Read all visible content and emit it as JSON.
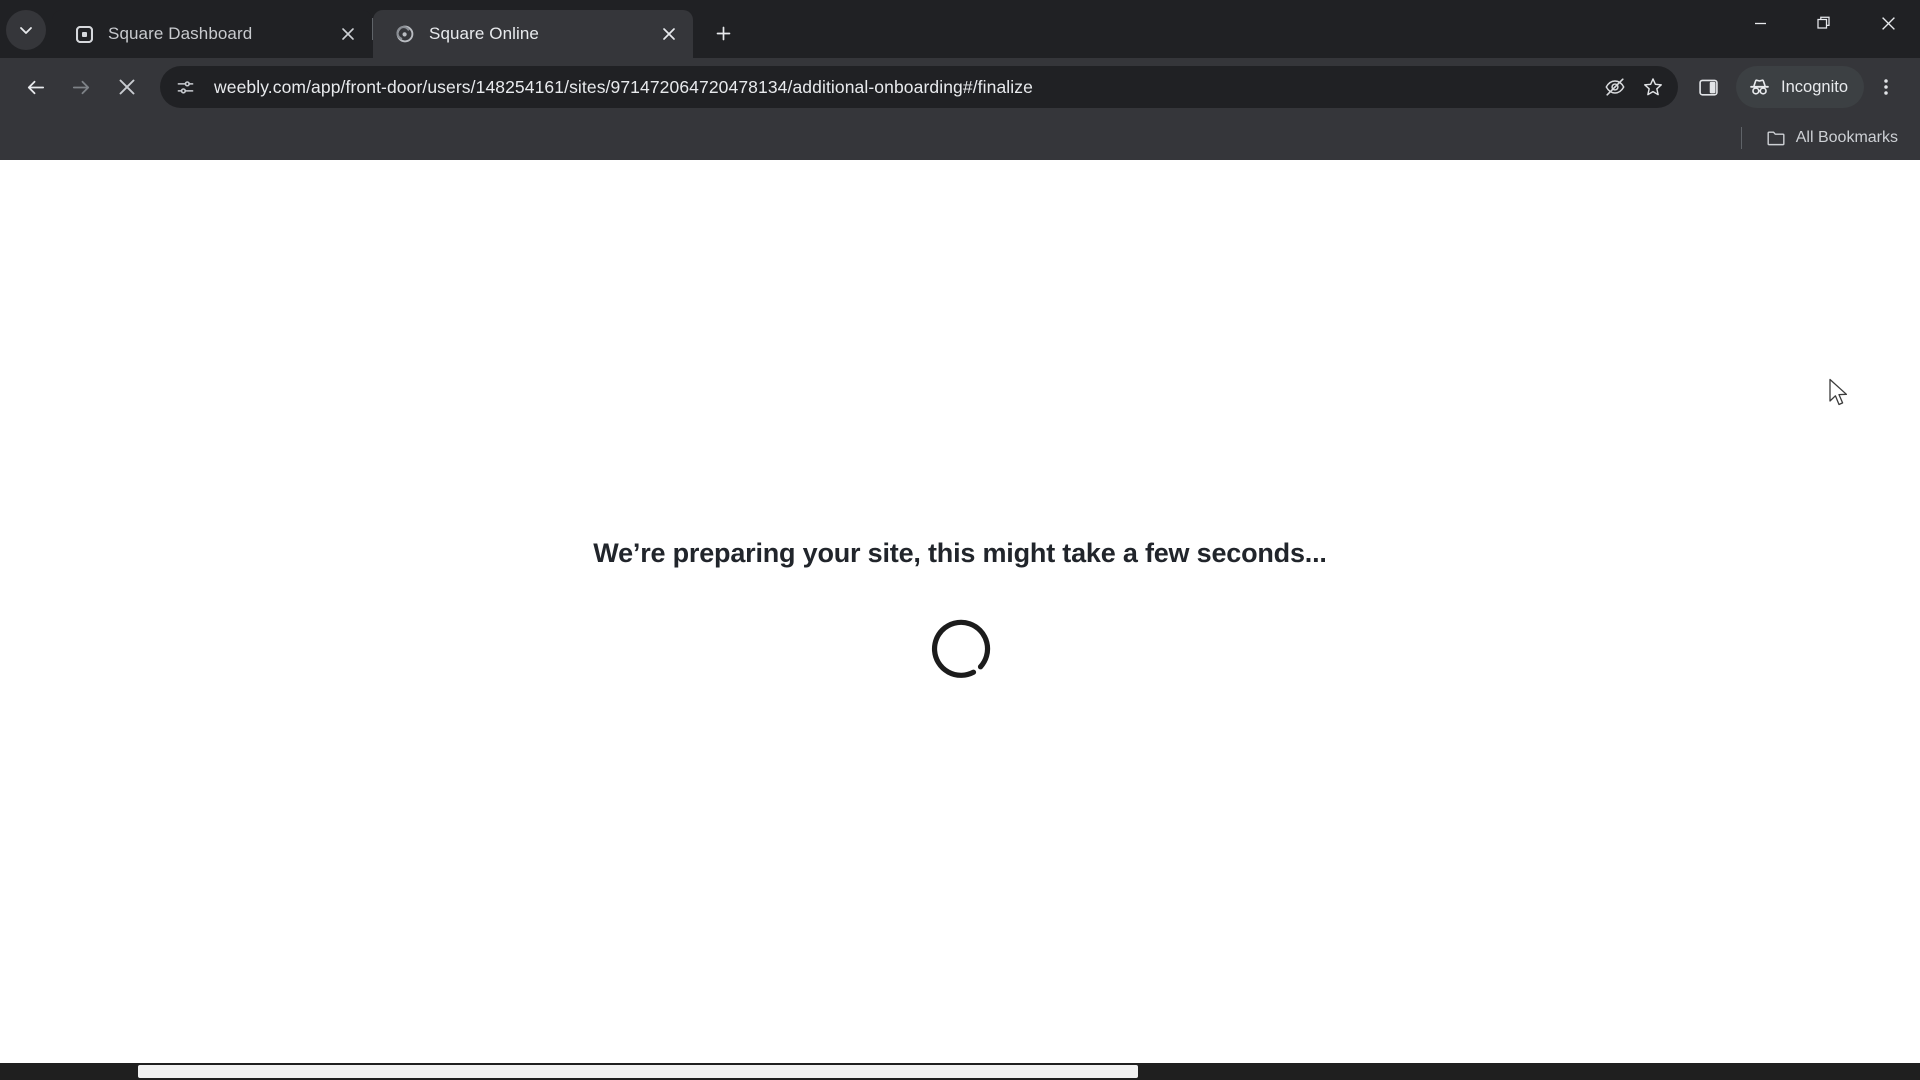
{
  "window": {
    "controls": [
      {
        "name": "minimize",
        "glyph": "minimize-icon"
      },
      {
        "name": "restore",
        "glyph": "restore-icon"
      },
      {
        "name": "close",
        "glyph": "close-icon"
      }
    ]
  },
  "tabstrip": {
    "tab_search_icon": "chevron-down-icon",
    "new_tab_icon": "plus-icon",
    "tabs": [
      {
        "title": "Square Dashboard",
        "favicon": "square-logo-icon",
        "active": false,
        "close_icon": "close-icon"
      },
      {
        "title": "Square Online",
        "favicon": "square-online-logo-icon",
        "active": true,
        "close_icon": "close-icon"
      }
    ]
  },
  "toolbar": {
    "back_icon": "arrow-left-icon",
    "forward_icon": "arrow-right-icon",
    "stop_icon": "stop-loading-icon",
    "site_info_icon": "tune-settings-icon",
    "url": "weebly.com/app/front-door/users/148254161/sites/971472064720478134/additional-onboarding#/finalize",
    "url_placeholder": "Search Google or type a URL",
    "tracking_protection_icon": "eye-off-icon",
    "bookmark_icon": "star-icon",
    "side_panel_icon": "side-panel-icon",
    "incognito_label": "Incognito",
    "incognito_icon": "incognito-hat-icon",
    "menu_icon": "three-dot-menu-icon"
  },
  "bookmarks_bar": {
    "all_bookmarks_label": "All Bookmarks",
    "folder_icon": "folder-icon"
  },
  "page": {
    "headline": "We’re preparing your site, this might take a few seconds...",
    "spinner": "loading-spinner",
    "spinner_color": "#1c1c1c",
    "background": "#ffffff",
    "text_color": "#21252b"
  },
  "colors": {
    "chrome_frame": "#202124",
    "chrome_toolbar": "#35363a",
    "omnibox": "#202124",
    "text_primary": "#e8eaed"
  }
}
